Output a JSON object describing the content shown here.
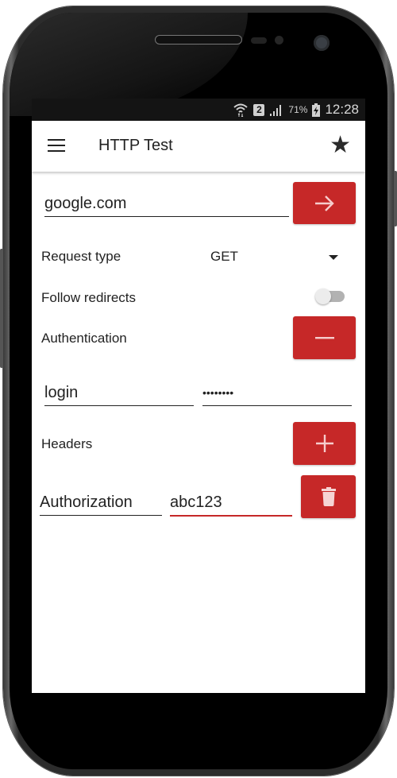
{
  "status_bar": {
    "sim_slot": "2",
    "battery": "71%",
    "time": "12:28",
    "icons": [
      "wifi-icon",
      "sim-icon",
      "signal-icon",
      "battery-charging-icon"
    ]
  },
  "toolbar": {
    "title": "HTTP Test",
    "menu_icon": "menu-icon",
    "favorite_icon": "star-icon"
  },
  "url": {
    "value": "google.com",
    "go_icon": "arrow-right-icon"
  },
  "request_type": {
    "label": "Request type",
    "selected": "GET"
  },
  "follow_redirects": {
    "label": "Follow redirects",
    "enabled": false
  },
  "authentication": {
    "label": "Authentication",
    "toggle_icon": "minus-icon",
    "login": "login",
    "password": "••••••••"
  },
  "headers": {
    "label": "Headers",
    "add_icon": "plus-icon",
    "items": [
      {
        "name": "Authorization",
        "value": "abc123",
        "delete_icon": "trash-icon"
      }
    ]
  },
  "colors": {
    "accent": "#c62828",
    "status_bar": "#141414"
  }
}
